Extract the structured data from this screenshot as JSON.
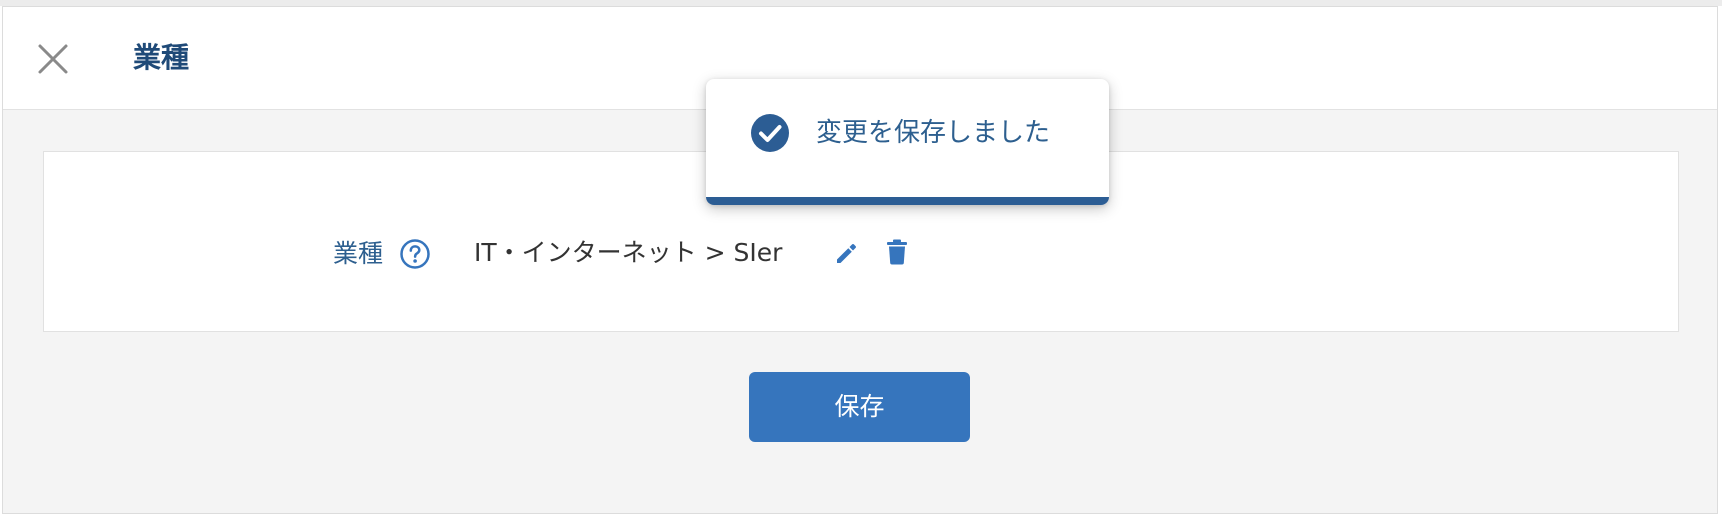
{
  "header": {
    "title": "業種",
    "close_icon": "close-icon"
  },
  "field": {
    "label": "業種",
    "help_icon": "question-circle-icon",
    "value": "IT・インターネット > SIer",
    "edit_icon": "pencil-icon",
    "delete_icon": "trash-icon"
  },
  "actions": {
    "save_label": "保存"
  },
  "toast": {
    "icon": "check-circle-icon",
    "message": "変更を保存しました"
  },
  "colors": {
    "accent": "#3675bd",
    "title_text": "#1f4a78",
    "label_text": "#2d5f8f",
    "toast_bar": "#2c5d94",
    "panel_bg": "#f4f4f4"
  }
}
